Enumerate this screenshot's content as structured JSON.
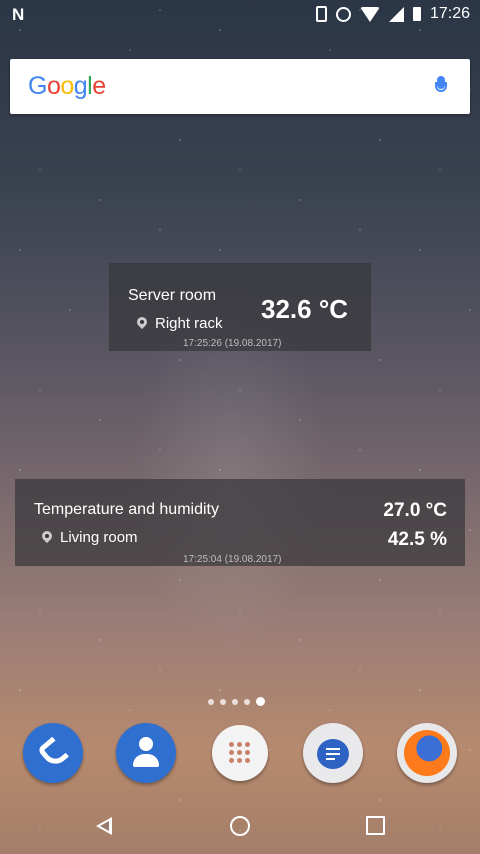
{
  "status_bar": {
    "notification_icon": "N",
    "time": "17:26",
    "icons": [
      "vibrate-icon",
      "alarm-icon",
      "wifi-icon",
      "signal-icon",
      "battery-icon"
    ]
  },
  "search": {
    "logo": [
      "G",
      "o",
      "o",
      "g",
      "l",
      "e"
    ],
    "logo_colors": [
      "#4285F4",
      "#EA4335",
      "#FBBC05",
      "#4285F4",
      "#34A853",
      "#EA4335"
    ]
  },
  "widgets": [
    {
      "name": "Server room",
      "location": "Right rack",
      "temperature": "32.6 °C",
      "timestamp": "17:25:26 (19.08.2017)"
    },
    {
      "name": "Temperature and humidity",
      "location": "Living room",
      "temperature": "27.0 °C",
      "humidity": "42.5 %",
      "timestamp": "17:25:04 (19.08.2017)"
    }
  ],
  "page_indicator": {
    "count": 5,
    "active": 5
  },
  "dock": [
    "phone",
    "contacts",
    "app-drawer",
    "messenger",
    "firefox"
  ],
  "nav": [
    "back",
    "home",
    "recents"
  ]
}
